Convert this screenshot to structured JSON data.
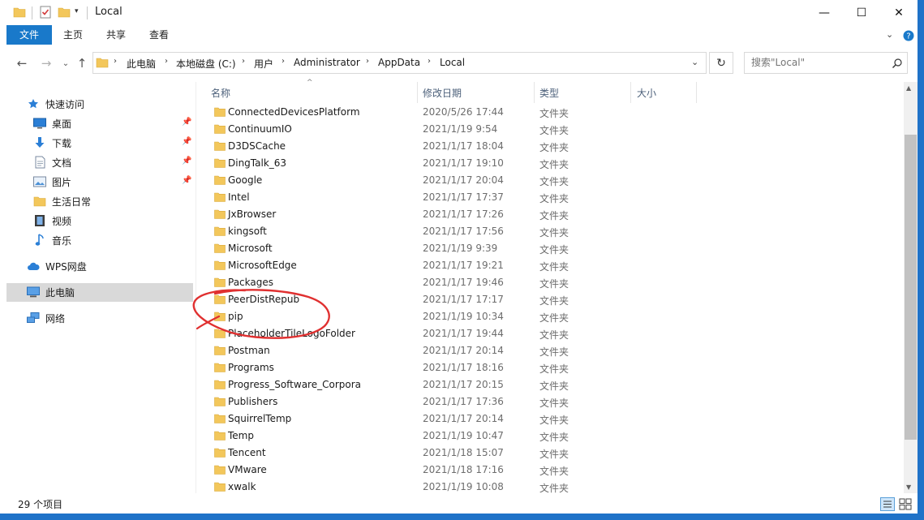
{
  "window": {
    "title": "Local",
    "minimize": "—",
    "maximize": "☐",
    "close": "✕"
  },
  "ribbon": {
    "tabs": [
      "文件",
      "主页",
      "共享",
      "查看"
    ]
  },
  "nav": {
    "back": "←",
    "forward": "→",
    "recent": "⌄",
    "up": "↑",
    "breadcrumbs": [
      "此电脑",
      "本地磁盘 (C:)",
      "用户",
      "Administrator",
      "AppData",
      "Local"
    ],
    "refresh": "↻",
    "search_placeholder": "搜索\"Local\"",
    "search_icon": "⌕"
  },
  "sidebar": {
    "items": [
      {
        "label": "快速访问",
        "icon": "star-icon"
      },
      {
        "label": "桌面",
        "icon": "desktop-icon",
        "pinned": true
      },
      {
        "label": "下载",
        "icon": "download-icon",
        "pinned": true
      },
      {
        "label": "文档",
        "icon": "document-icon",
        "pinned": true
      },
      {
        "label": "图片",
        "icon": "picture-icon",
        "pinned": true
      },
      {
        "label": "生活日常",
        "icon": "folder-icon"
      },
      {
        "label": "视频",
        "icon": "video-icon"
      },
      {
        "label": "音乐",
        "icon": "music-icon"
      },
      {
        "label": "WPS网盘",
        "icon": "cloud-icon"
      },
      {
        "label": "此电脑",
        "icon": "computer-icon",
        "selected": true
      },
      {
        "label": "网络",
        "icon": "network-icon"
      }
    ]
  },
  "columns": {
    "name": "名称",
    "date": "修改日期",
    "type": "类型",
    "size": "大小"
  },
  "files": [
    {
      "name": "ConnectedDevicesPlatform",
      "date": "2020/5/26 17:44",
      "type": "文件夹"
    },
    {
      "name": "ContinuumIO",
      "date": "2021/1/19 9:54",
      "type": "文件夹"
    },
    {
      "name": "D3DSCache",
      "date": "2021/1/17 18:04",
      "type": "文件夹"
    },
    {
      "name": "DingTalk_63",
      "date": "2021/1/17 19:10",
      "type": "文件夹"
    },
    {
      "name": "Google",
      "date": "2021/1/17 20:04",
      "type": "文件夹"
    },
    {
      "name": "Intel",
      "date": "2021/1/17 17:37",
      "type": "文件夹"
    },
    {
      "name": "JxBrowser",
      "date": "2021/1/17 17:26",
      "type": "文件夹"
    },
    {
      "name": "kingsoft",
      "date": "2021/1/17 17:56",
      "type": "文件夹"
    },
    {
      "name": "Microsoft",
      "date": "2021/1/19 9:39",
      "type": "文件夹"
    },
    {
      "name": "MicrosoftEdge",
      "date": "2021/1/17 19:21",
      "type": "文件夹"
    },
    {
      "name": "Packages",
      "date": "2021/1/17 19:46",
      "type": "文件夹"
    },
    {
      "name": "PeerDistRepub",
      "date": "2021/1/17 17:17",
      "type": "文件夹"
    },
    {
      "name": "pip",
      "date": "2021/1/19 10:34",
      "type": "文件夹"
    },
    {
      "name": "PlaceholderTileLogoFolder",
      "date": "2021/1/17 19:44",
      "type": "文件夹"
    },
    {
      "name": "Postman",
      "date": "2021/1/17 20:14",
      "type": "文件夹"
    },
    {
      "name": "Programs",
      "date": "2021/1/17 18:16",
      "type": "文件夹"
    },
    {
      "name": "Progress_Software_Corpora",
      "date": "2021/1/17 20:15",
      "type": "文件夹"
    },
    {
      "name": "Publishers",
      "date": "2021/1/17 17:36",
      "type": "文件夹"
    },
    {
      "name": "SquirrelTemp",
      "date": "2021/1/17 20:14",
      "type": "文件夹"
    },
    {
      "name": "Temp",
      "date": "2021/1/19 10:47",
      "type": "文件夹"
    },
    {
      "name": "Tencent",
      "date": "2021/1/18 15:07",
      "type": "文件夹"
    },
    {
      "name": "VMware",
      "date": "2021/1/18 17:16",
      "type": "文件夹"
    },
    {
      "name": "xwalk",
      "date": "2021/1/19 10:08",
      "type": "文件夹"
    }
  ],
  "status": {
    "count": "29 个项目"
  },
  "colors": {
    "accent": "#1979ca",
    "folder": "#f3c75b",
    "annotation": "#e03030"
  }
}
